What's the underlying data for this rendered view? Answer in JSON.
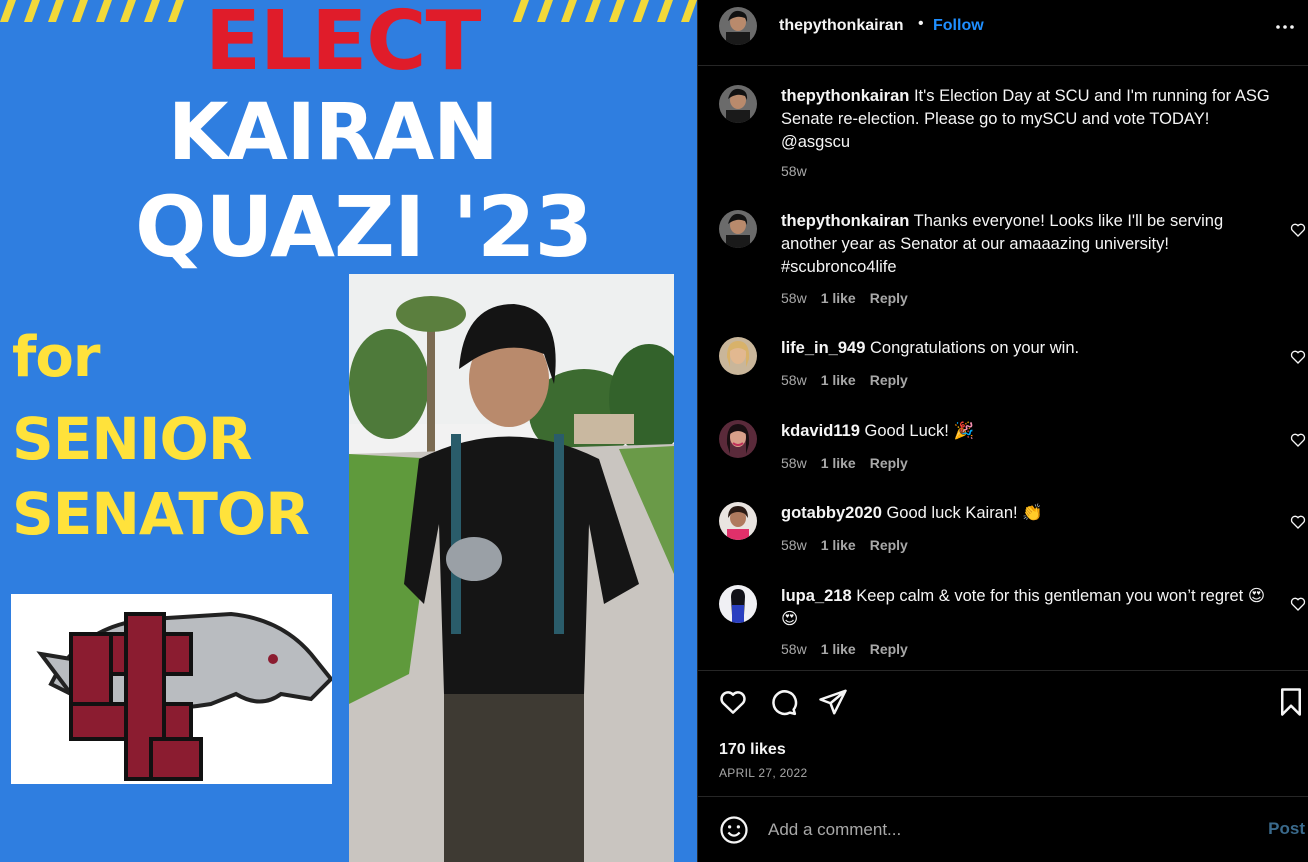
{
  "poster": {
    "elect": "ELECT",
    "name_line1": "KAIRAN",
    "name_line2": "QUAZI '23",
    "for": "for",
    "line_senior": "SENIOR",
    "line_senator": "SENATOR",
    "colors": {
      "background": "#2f7ee0",
      "elect": "#e01c2a",
      "yellow": "#ffe23b",
      "logo_maroon": "#8b1c30"
    }
  },
  "header": {
    "username": "thepythonkairan",
    "separator": "•",
    "follow_label": "Follow"
  },
  "comments": [
    {
      "username": "thepythonkairan",
      "text": "It's Election Day at SCU and I'm running for ASG Senate re-election. Please go to mySCU and vote TODAY! @asgscu",
      "time": "58w",
      "likes": "",
      "reply": ""
    },
    {
      "username": "thepythonkairan",
      "text": "Thanks everyone! Looks like I'll be serving another year as Senator at our amaaazing university! #scubronco4life",
      "time": "58w",
      "likes": "1 like",
      "reply": "Reply"
    },
    {
      "username": "life_in_949",
      "text": "Congratulations on your win.",
      "time": "58w",
      "likes": "1 like",
      "reply": "Reply"
    },
    {
      "username": "kdavid119",
      "text": "Good Luck! 🎉",
      "time": "58w",
      "likes": "1 like",
      "reply": "Reply"
    },
    {
      "username": "gotabby2020",
      "text": "Good luck Kairan! 👏",
      "time": "58w",
      "likes": "1 like",
      "reply": "Reply"
    },
    {
      "username": "lupa_218",
      "text": "Keep calm & vote for this gentleman you won’t regret 😍😍",
      "time": "58w",
      "likes": "1 like",
      "reply": "Reply"
    }
  ],
  "actions": {
    "likes_count": "170 likes",
    "date": "APRIL 27, 2022",
    "icons": [
      "heart-icon",
      "comment-icon",
      "share-icon",
      "bookmark-icon"
    ]
  },
  "add_comment": {
    "placeholder": "Add a comment...",
    "post_label": "Post"
  }
}
